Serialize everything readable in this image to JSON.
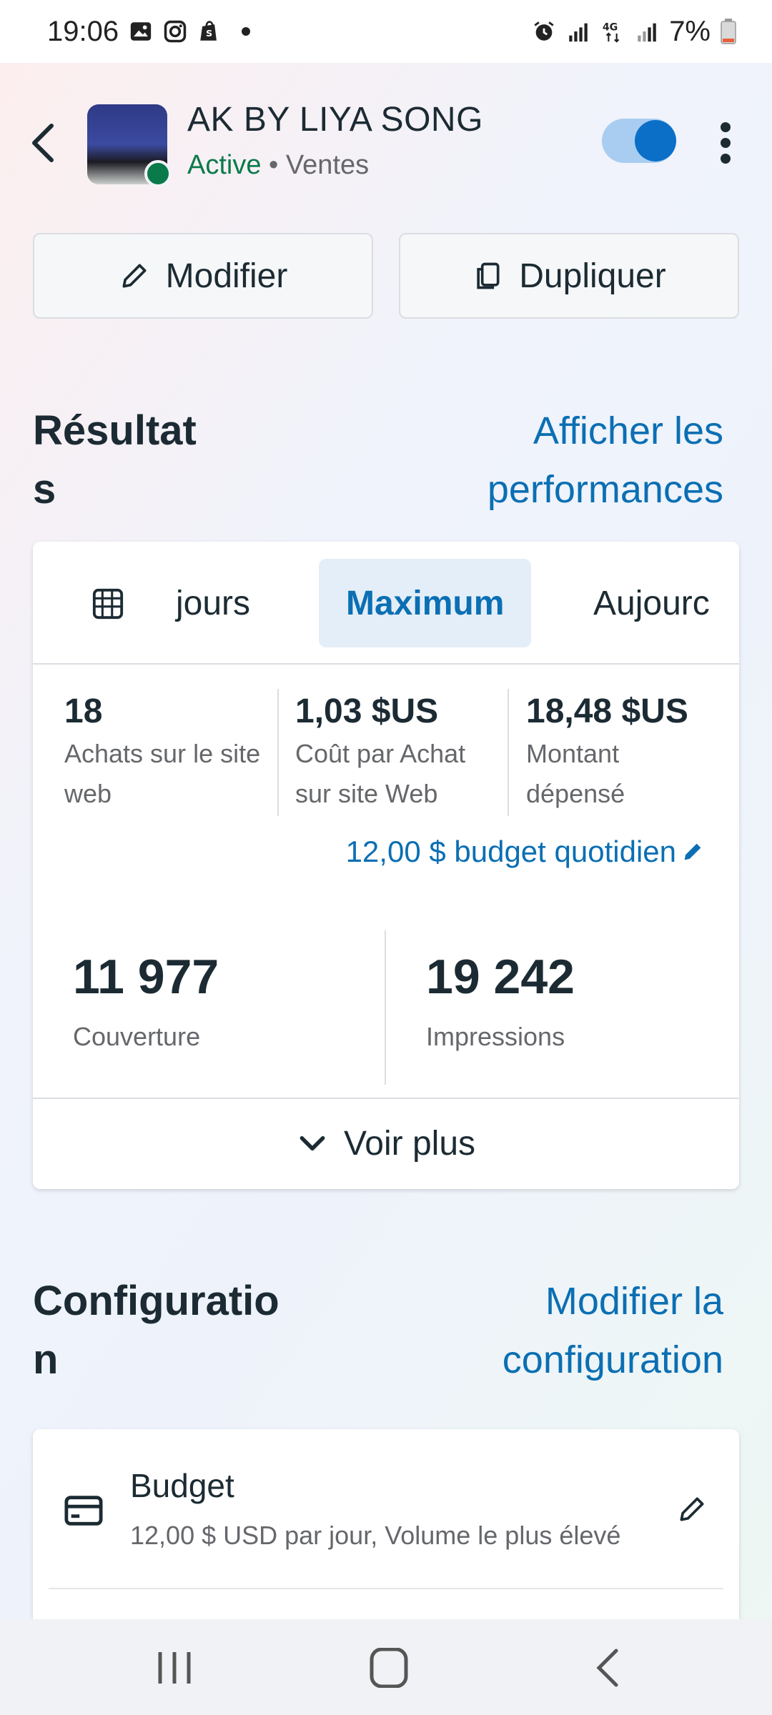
{
  "status_bar": {
    "time": "19:06",
    "notification_icons": [
      "gallery-icon",
      "instagram-icon",
      "shopify-icon"
    ],
    "right_icons": [
      "alarm-icon",
      "signal-icon",
      "4g-icon",
      "signal-icon"
    ],
    "battery": "7%"
  },
  "header": {
    "title": "AK BY LIYA SONG",
    "status": "Active",
    "separator": "•",
    "objective": "Ventes",
    "toggle_on": true
  },
  "actions": {
    "edit_label": "Modifier",
    "duplicate_label": "Dupliquer"
  },
  "results": {
    "title_line1": "Résultat",
    "title_line2": "s",
    "link_line1": "Afficher les",
    "link_line2": "performances",
    "tabs": [
      {
        "label": "jours",
        "active": false
      },
      {
        "label": "Maximum",
        "active": true
      },
      {
        "label": "Aujourc",
        "active": false
      }
    ],
    "metrics": [
      {
        "value": "18",
        "label": "Achats sur le site web"
      },
      {
        "value": "1,03 $US",
        "label": "Coût par Achat sur site Web"
      },
      {
        "value": "18,48 $US",
        "label": "Montant dépensé"
      }
    ],
    "budget_link": "12,00 $ budget quotidien",
    "big_metrics": [
      {
        "value": "11 977",
        "label": "Couverture"
      },
      {
        "value": "19 242",
        "label": "Impressions"
      }
    ],
    "see_more": "Voir plus"
  },
  "configuration": {
    "title_line1": "Configuratio",
    "title_line2": "n",
    "link_line1": "Modifier la",
    "link_line2": "configuration",
    "budget": {
      "title": "Budget",
      "description": "12,00 $ USD par jour, Volume le plus élevé"
    }
  },
  "colors": {
    "accent": "#0b6fb3",
    "status_green": "#0a7a4a",
    "toggle_track": "#a9cdf0",
    "toggle_knob": "#0b6fc8"
  }
}
